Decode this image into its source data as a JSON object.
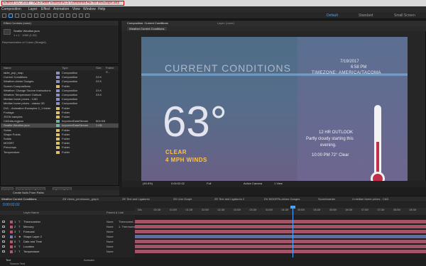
{
  "window_title": "Effects CC 2018 - \\\\ALS After Effects\\KLS Combined AE for MoGraph.aep *",
  "menu": [
    "Composition",
    "Layer",
    "Effect",
    "Animation",
    "View",
    "Window",
    "Help"
  ],
  "workspaces": [
    "Default",
    "Standard",
    "Small Screen"
  ],
  "effect_panel": {
    "tab": "Effect Controls (none)",
    "item_name": "Seattle Weather.json",
    "item_meta1": "1 x 1 · 1080 (1.00)",
    "item_meta2": "Representation of Colors (Straight)"
  },
  "project_items": [
    {
      "name": "table_pop_map",
      "type": "Composition",
      "size": ""
    },
    {
      "name": "Current Conditions",
      "type": "Composition",
      "size": "23 K"
    },
    {
      "name": "Weather-driven Gauges",
      "type": "Composition",
      "size": "23 K"
    },
    {
      "name": "Screen Compositions",
      "type": "Folder",
      "size": ""
    },
    {
      "name": "Weather: Change Source Instructions",
      "type": "Composition",
      "size": "23 K"
    },
    {
      "name": "Weather Temperature Outlook",
      "type": "Composition",
      "size": "23 K"
    },
    {
      "name": "Median home prices - CAD",
      "type": "Composition",
      "size": ""
    },
    {
      "name": "Median home prices - classic 3D",
      "type": "Composition",
      "size": ""
    },
    {
      "name": "DVL - Animation Examples 2_1 folder",
      "type": "Folder",
      "size": ""
    },
    {
      "name": "Footage",
      "type": "Folder",
      "size": ""
    },
    {
      "name": "JSON samples",
      "type": "Folder",
      "size": ""
    },
    {
      "name": "CAData.mgjson",
      "type": "ImportedDataStream",
      "size": "604 KB"
    },
    {
      "name": "Seattle Weather.json",
      "type": "ImportedDataStream",
      "size": "1 KB"
    },
    {
      "name": "Solids",
      "type": "Folder",
      "size": ""
    },
    {
      "name": "Shape Points",
      "type": "Folder",
      "size": ""
    },
    {
      "name": "Solids",
      "type": "Folder",
      "size": ""
    },
    {
      "name": "MOGRT",
      "type": "Folder",
      "size": ""
    },
    {
      "name": "Precomps",
      "type": "Folder",
      "size": ""
    },
    {
      "name": "Temperature",
      "type": "Folder",
      "size": ""
    }
  ],
  "project_headers": {
    "name": "Name",
    "type": "Type",
    "size": "Size",
    "frame": "Frame R..."
  },
  "project_buttons": {
    "nulls": "Nulls",
    "follow": "Nulls Follow Points",
    "trace": "Trace Path",
    "create": "Create Nulls From Paths"
  },
  "viewer": {
    "tab": "Composition: Current Conditions",
    "tab_layer": "Layer: (none)",
    "subtab": "Weather Current Conditions",
    "zoom": "(49.5%)",
    "timecode": "0:00:02:02",
    "resolution": "Full",
    "camera": "Active Camera",
    "views": "1 View"
  },
  "comp": {
    "title": "CURRENT CONDITIONS",
    "date": "7/19/2017",
    "time": "6:58 PM",
    "timezone": "TIMEZONE: AMERICA/TACOMA",
    "temperature": "63°",
    "condition": "CLEAR",
    "wind": "4 MPH WINDS",
    "outlook_title": "12 HR OUTLOOK",
    "outlook_line1": "Partly cloudy starting this",
    "outlook_line2": "evening.",
    "forecast": "10:00 PM 72° Clear",
    "thermometer_level": 0.5
  },
  "timeline_tabs": [
    "Weather Current Conditions",
    "ZB Views_permission_graph",
    "ZE Text and Ligatures",
    "ZD Line Graph",
    "ZE Text and Ligatures 2",
    "DV MOGRTs-driven Gauges",
    "Scoreboarder",
    "4 median home prices - CAD"
  ],
  "timecode": "0:00:02:02",
  "layers": [
    {
      "num": "1",
      "name": "Thermometer",
      "parent": "None",
      "link": "Thermomet..."
    },
    {
      "num": "2",
      "name": "Mercury",
      "parent": "None",
      "link": "1. Thermomet..."
    },
    {
      "num": "3",
      "name": "Forecast",
      "parent": "None",
      "link": ""
    },
    {
      "num": "4",
      "name": "Shape Layer 2",
      "parent": "None",
      "link": ""
    },
    {
      "num": "5",
      "name": "Date and Time",
      "parent": "None",
      "link": ""
    },
    {
      "num": "6",
      "name": "Location",
      "parent": "None",
      "link": ""
    },
    {
      "num": "7",
      "name": "Temperature",
      "parent": "None",
      "link": ""
    }
  ],
  "layer_headers": {
    "name": "Layer Name",
    "parent": "Parent & Link"
  },
  "ruler_ticks": [
    "00s",
    "00:15f",
    "01:00f",
    "01:15f",
    "02:00f",
    "02:15f",
    "03:00f",
    "03:15f",
    "04:00f",
    "04:15f",
    "05:00f",
    "05:15f",
    "06:00f",
    "06:15f",
    "07:00f",
    "07:15f",
    "08:00f",
    "08:15f"
  ],
  "bottom": {
    "text_label": "Text",
    "source_text": "Source Text",
    "animate": "Animate:"
  }
}
